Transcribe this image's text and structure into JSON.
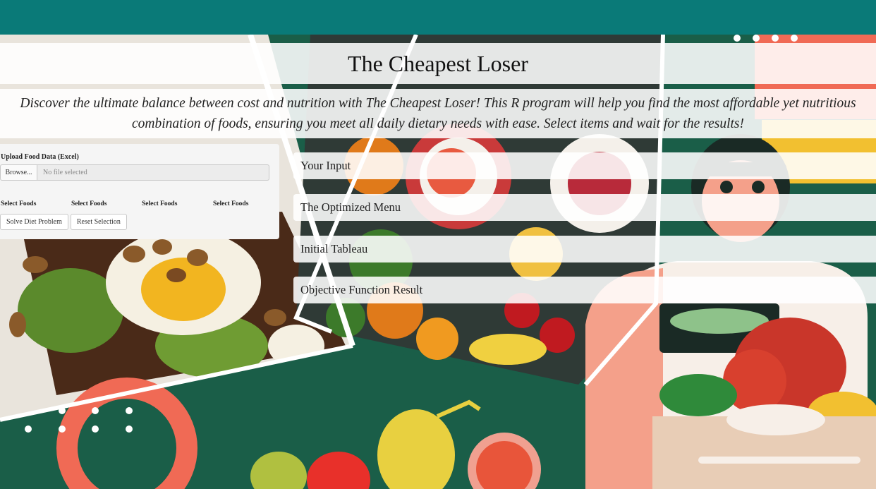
{
  "app": {
    "title": "The Cheapest Loser",
    "description": "Discover the ultimate balance between cost and nutrition with The Cheapest Loser! This R program will help you find the most affordable yet nutritious combination of foods, ensuring you meet all daily dietary needs with ease. Select items and wait for the results!"
  },
  "sidebar": {
    "upload_label": "Upload Food Data (Excel)",
    "browse_label": "Browse...",
    "file_placeholder": "No file selected",
    "select_labels": [
      "Select Foods",
      "Select Foods",
      "Select Foods",
      "Select Foods"
    ],
    "buttons": {
      "solve": "Solve Diet Problem",
      "reset": "Reset Selection"
    }
  },
  "panels": [
    {
      "label": "Your Input"
    },
    {
      "label": "The Optimized Menu"
    },
    {
      "label": "Initial Tableau"
    },
    {
      "label": "Objective Function Result"
    }
  ],
  "colors": {
    "top_bar": "#0a7a78",
    "background": "#1a5e48",
    "panel_bg": "#ffffff",
    "sidebar_bg": "#f5f5f5"
  }
}
